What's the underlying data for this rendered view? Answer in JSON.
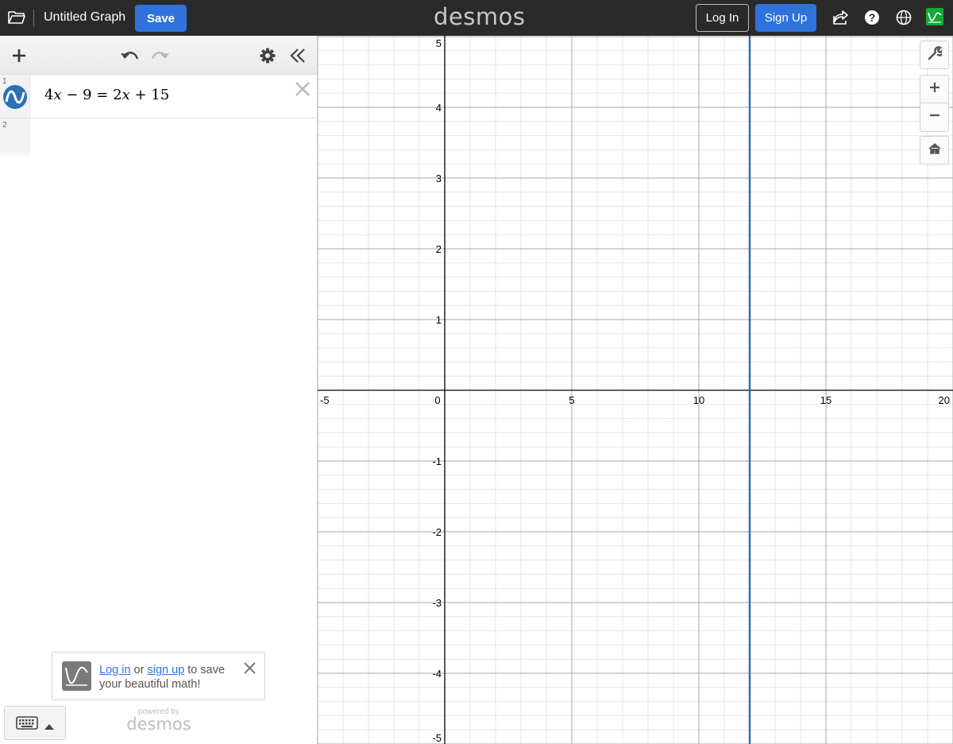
{
  "header": {
    "graph_title": "Untitled Graph",
    "save_label": "Save",
    "logo": "desmos",
    "login_label": "Log In",
    "signup_label": "Sign Up",
    "icons": [
      "folder-icon",
      "share-icon",
      "help-icon",
      "language-icon",
      "profile-graph-icon"
    ]
  },
  "expressions": {
    "toolbar_icons": [
      "add-icon",
      "undo-icon",
      "redo-icon",
      "settings-icon",
      "collapse-icon"
    ],
    "items": [
      {
        "index": "1",
        "latex_parts": [
          "4",
          "x",
          " − 9 = 2",
          "x",
          " + 15"
        ],
        "color": "#2d70b3"
      },
      {
        "index": "2",
        "latex_parts": []
      }
    ]
  },
  "toast": {
    "login_link": "Log in",
    "or_text": " or ",
    "signup_link": "sign up",
    "rest_text": " to save your beautiful math!"
  },
  "footer": {
    "powered_by": "powered by",
    "logo": "desmos"
  },
  "graph_controls": [
    "wrench-icon",
    "zoom-in-icon",
    "zoom-out-icon",
    "home-icon"
  ],
  "chart_data": {
    "type": "line",
    "xlim": [
      -5,
      20
    ],
    "ylim": [
      -5,
      5
    ],
    "x_ticks": [
      -5,
      0,
      5,
      10,
      15,
      20
    ],
    "y_ticks": [
      -5,
      -4,
      -3,
      -2,
      -1,
      1,
      2,
      3,
      4,
      5
    ],
    "x_tick_labels": [
      "-5",
      "0",
      "5",
      "10",
      "15",
      "20"
    ],
    "y_tick_labels": [
      "-5",
      "-4",
      "-3",
      "-2",
      "-1",
      "1",
      "2",
      "3",
      "4",
      "5"
    ],
    "grid": true,
    "series": [
      {
        "vertical_line_x": 12,
        "color": "#2d70b3"
      }
    ]
  }
}
